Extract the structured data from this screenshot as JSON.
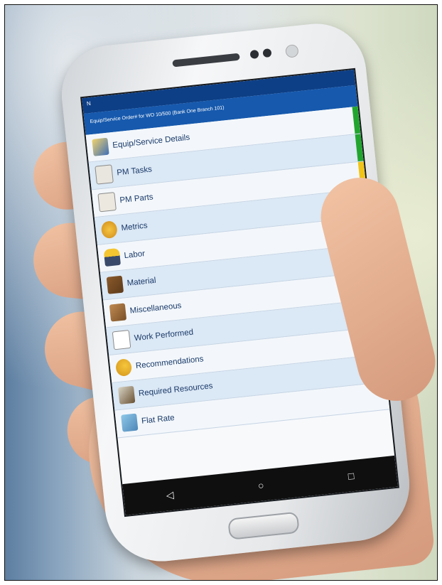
{
  "app": {
    "status_icon": "N",
    "title": "Equip/Service Order# for WO 10/500 (Bank One Branch 101)"
  },
  "menu": {
    "items": [
      {
        "label": "Equip/Service Details",
        "icon": "equipment-icon",
        "status_color": "#22a52f"
      },
      {
        "label": "PM Tasks",
        "icon": "checklist-icon",
        "status_color": "#22a52f"
      },
      {
        "label": "PM Parts",
        "icon": "parts-list-icon",
        "status_color": "#f0c419"
      },
      {
        "label": "Metrics",
        "icon": "gauge-icon",
        "status_color": "#22a52f"
      },
      {
        "label": "Labor",
        "icon": "worker-icon",
        "status_color": "#d81f1f"
      },
      {
        "label": "Material",
        "icon": "material-box-icon",
        "status_color": "#d81f1f"
      },
      {
        "label": "Miscellaneous",
        "icon": "box-icon",
        "status_color": "#d81f1f"
      },
      {
        "label": "Work Performed",
        "icon": "document-icon",
        "status_color": "#f0c419"
      },
      {
        "label": "Recommendations",
        "icon": "recommendation-icon",
        "status_color": "#f0c419"
      },
      {
        "label": "Required Resources",
        "icon": "resources-icon",
        "status_color": "#f0c419"
      },
      {
        "label": "Flat Rate",
        "icon": "flat-rate-icon",
        "status_color": ""
      }
    ]
  },
  "navbar": {
    "back_icon": "◁",
    "home_icon": "○",
    "recents_icon": "□"
  }
}
